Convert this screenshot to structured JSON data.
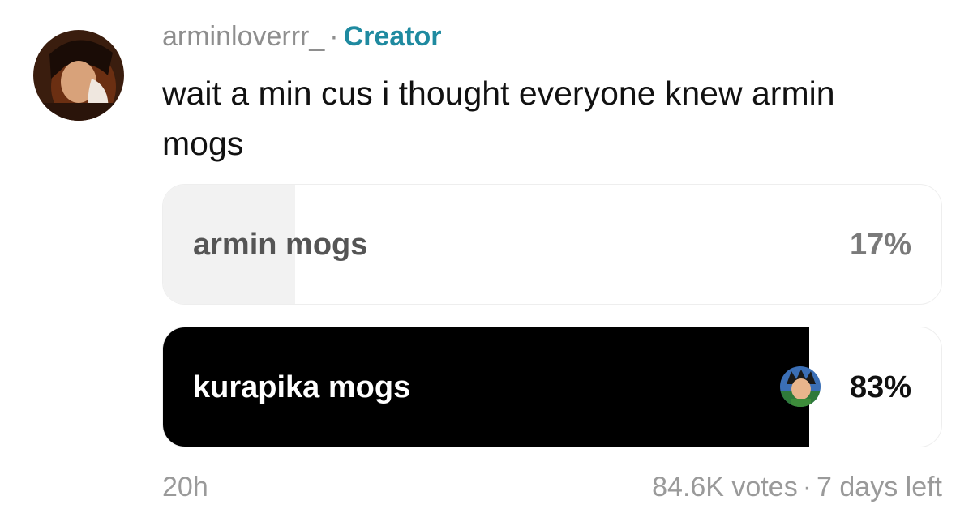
{
  "post": {
    "username": "arminloverrr_",
    "separator": "·",
    "role_badge": "Creator",
    "comment": "wait a min cus i thought everyone knew armin mogs"
  },
  "poll": {
    "options": [
      {
        "label": "armin mogs",
        "percent_label": "17%",
        "share": 0.17,
        "selected": false
      },
      {
        "label": "kurapika mogs",
        "percent_label": "83%",
        "share": 0.83,
        "selected": true
      }
    ]
  },
  "footer": {
    "time_ago": "20h",
    "votes": "84.6K votes",
    "separator": "·",
    "time_left": "7 days left"
  },
  "colors": {
    "creator": "#1f8aa0",
    "selected_fill": "#000000",
    "unselected_fill": "#f2f2f2"
  }
}
